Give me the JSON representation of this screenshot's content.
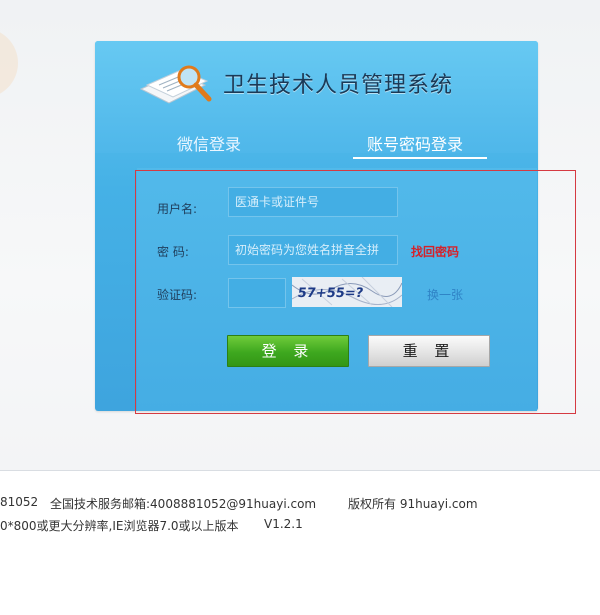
{
  "system": {
    "title": "卫生技术人员管理系统"
  },
  "tabs": [
    {
      "label": "微信登录",
      "active": false
    },
    {
      "label": "账号密码登录",
      "active": true
    }
  ],
  "form": {
    "username_label": "用户名:",
    "username_placeholder": "医通卡或证件号",
    "password_label": "密 码:",
    "password_placeholder": "初始密码为您姓名拼音全拼",
    "forgot_password": "找回密码",
    "captcha_label": "验证码:",
    "captcha_text": "57+55=?",
    "refresh_text": "换一张"
  },
  "buttons": {
    "login": "登 录",
    "reset": "重 置"
  },
  "footer": {
    "phone_partial": "81052",
    "service_email": "全国技术服务邮箱:4008881052@91huayi.com",
    "copyright": "版权所有 91huayi.com",
    "resolution_note": "0*800或更大分辨率,IE浏览器7.0或以上版本",
    "version": "V1.2.1"
  },
  "colors": {
    "panel_blue": "#45b1e6",
    "login_green": "#3ea81f",
    "forgot_red": "#d4222b",
    "highlight_red": "#d53a42"
  }
}
